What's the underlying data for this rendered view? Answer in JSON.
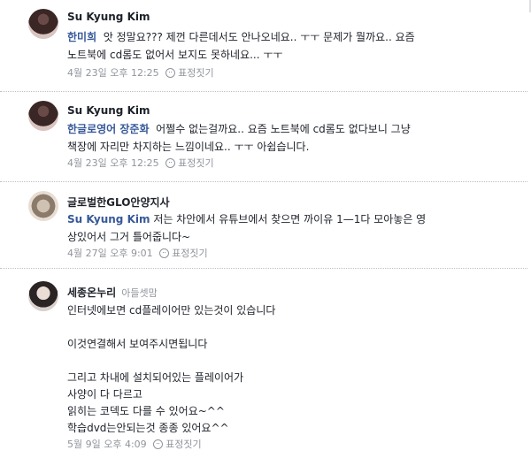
{
  "comments": [
    {
      "author": "Su Kyung Kim",
      "author_sub": "",
      "mention": "한미희",
      "lines": [
        "앗 정말요??? 제껀 다른데서도 안나오네요.. ㅜㅜ 문제가 뭘까요.. 요즘",
        "노트북에 cd롬도 없어서 보지도 못하네요... ㅜㅜ"
      ],
      "timestamp": "4월 23일 오후 12:25",
      "reaction_label": "표정짓기",
      "avatar_icon": "profile-photo"
    },
    {
      "author": "Su Kyung Kim",
      "author_sub": "",
      "mention": "한글로영어 장준화",
      "lines": [
        "어쩔수 없는걸까요.. 요즘 노트북에 cd롬도 없다보니 그냥",
        "책장에 자리만 차지하는 느낌이네요.. ㅜㅜ 아쉽습니다."
      ],
      "timestamp": "4월 23일 오후 12:25",
      "reaction_label": "표정짓기",
      "avatar_icon": "profile-photo"
    },
    {
      "author": "글로벌한GLO안양지사",
      "author_sub": "",
      "mention": "Su Kyung  Kim",
      "lines": [
        "저는 차안에서 유튜브에서 찾으면 까이유 1—1다 모아놓은 영",
        "상있어서 그거 틀어줍니다~"
      ],
      "timestamp": "4월 27일 오후 9:01",
      "reaction_label": "표정짓기",
      "avatar_icon": "profile-photo"
    },
    {
      "author": "세종온누리",
      "author_sub": "아들셋맘",
      "mention": "",
      "lines": [
        "인터넷에보면 cd플레이어만 있는것이 있습니다",
        "",
        "이것연결해서 보여주시면됩니다",
        "",
        "그리고 차내에 설치되어있는 플레이어가",
        "사양이 다 다르고",
        "읽히는 코덱도 다를 수 있어요~^^",
        "학습dvd는안되는것 종종 있어요^^"
      ],
      "timestamp": "5월 9일 오후 4:09",
      "reaction_label": "표정짓기",
      "avatar_icon": "profile-photo"
    }
  ]
}
